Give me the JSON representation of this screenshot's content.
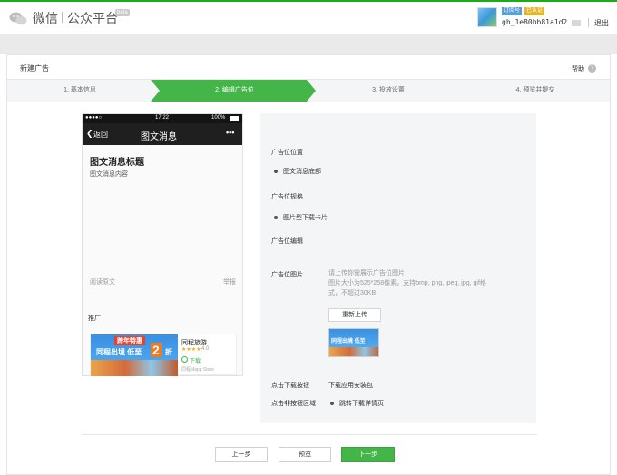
{
  "header": {
    "brand": "微信",
    "platform": "公众平台",
    "beta_badge": "beta",
    "account": {
      "badge_1": "订阅号",
      "badge_2": "已认证",
      "name": "gh_1e80bb81a1d2"
    },
    "logout_label": "退出"
  },
  "page": {
    "title": "新建广告",
    "help_label": "帮助"
  },
  "steps": [
    {
      "label": "1. 基本信息",
      "active": false
    },
    {
      "label": "2. 编辑广告位",
      "active": true
    },
    {
      "label": "3. 投放设置",
      "active": false
    },
    {
      "label": "4. 预览并提交",
      "active": false
    }
  ],
  "phone": {
    "status": {
      "carrier": "●●●●○",
      "time": "17:22",
      "battery": "100%"
    },
    "nav": {
      "back_label": "返回",
      "title": "图文消息",
      "more": "•••"
    },
    "message_title": "图文消息标题",
    "message_content": "图文消息内容",
    "read_more": "阅读原文",
    "report": "举报",
    "promo_label": "推广",
    "ad": {
      "banner_top": "跨年特惠",
      "banner_main": "同程出境 低至",
      "banner_number": "2",
      "banner_suffix": "折",
      "app_name": "同程旅游",
      "rating_stars": "★★★★",
      "rating": "4.0",
      "download_label": "下载",
      "developer": "同程Mapp Store"
    }
  },
  "settings": {
    "position_label": "广告位位置",
    "position_value": "图文消息底部",
    "spec_label": "广告位规格",
    "spec_value": "图片型下载卡片",
    "edit_label": "广告位编辑",
    "image_label": "广告位图片",
    "image_hint_1": "请上传你需展示广告位图片",
    "image_hint_2": "图片大小为525*258像素，支持bmp, png, jpeg, jpg, gif格",
    "image_hint_3": "式，不超过30KB",
    "reupload_label": "重新上传",
    "click_download_label": "点击下载按钮",
    "click_download_value": "下载应用安装包",
    "click_other_label": "点击非按钮区域",
    "click_other_value": "跳转下载详情页"
  },
  "footer": {
    "prev_label": "上一步",
    "preview_label": "预览",
    "next_label": "下一步"
  },
  "colors": {
    "accent": "#44b549",
    "header_line": "#1aad19",
    "panel_bg": "#f4f5f7"
  }
}
